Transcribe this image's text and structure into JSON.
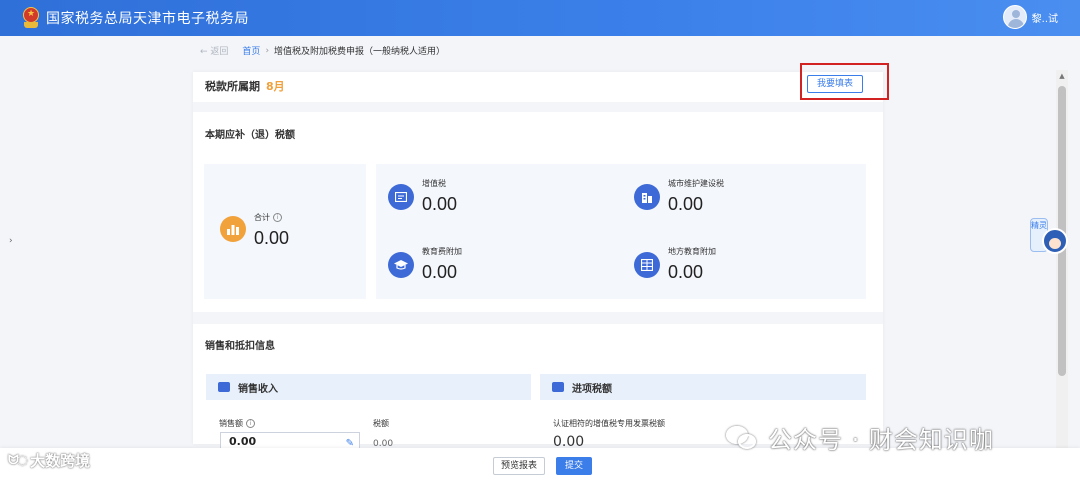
{
  "header": {
    "site_title": "国家税务总局天津市电子税务局",
    "user_name": "黎..试"
  },
  "breadcrumb": {
    "back": "返回",
    "home": "首页",
    "current": "增值税及附加税费申报（一般纳税人适用）"
  },
  "period": {
    "label": "税款所属期",
    "month": "8月",
    "fill_button": "我要填表"
  },
  "tax_due": {
    "title": "本期应补（退）税额",
    "total": {
      "label": "合计",
      "value": "0.00"
    },
    "items": [
      {
        "label": "增值税",
        "value": "0.00",
        "icon": "invoice-icon"
      },
      {
        "label": "城市维护建设税",
        "value": "0.00",
        "icon": "building-icon"
      },
      {
        "label": "教育费附加",
        "value": "0.00",
        "icon": "graduation-cap-icon"
      },
      {
        "label": "地方教育附加",
        "value": "0.00",
        "icon": "ledger-icon"
      }
    ]
  },
  "sales": {
    "title": "销售和抵扣信息",
    "revenue_header": "销售收入",
    "input_tax_header": "进项税额",
    "sales_amount_label": "销售额",
    "sales_amount_value": "0.00",
    "tax_label": "税额",
    "tax_value": "0.00",
    "certified_label": "认证相符的增值税专用发票税额",
    "certified_value": "0.00"
  },
  "footer": {
    "preview_button": "预览报表",
    "submit_button": "提交"
  },
  "assistant": {
    "text": "精灵"
  },
  "watermarks": {
    "left": "大数跨境",
    "right": "公众号 · 财会知识咖"
  },
  "colors": {
    "brand_blue": "#3b7de9",
    "accent_orange": "#f0a13b",
    "highlight_red": "#d32222"
  }
}
